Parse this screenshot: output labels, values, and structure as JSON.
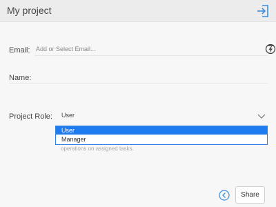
{
  "header": {
    "title": "My project",
    "exit_icon": "sign-in-icon"
  },
  "form": {
    "email": {
      "label": "Email:",
      "placeholder": "Add or Select Email...",
      "value": "",
      "action_icon": "bolt-icon"
    },
    "name": {
      "label": "Name:",
      "value": ""
    },
    "project_role": {
      "label": "Project Role:",
      "selected": "User",
      "options": [
        "User",
        "Manager"
      ],
      "description": "operations on assigned tasks."
    }
  },
  "footer": {
    "back_icon": "chevron-left-circle-icon",
    "share_label": "Share"
  },
  "colors": {
    "accent": "#1e7cf0",
    "header_bg": "#ececec",
    "page_bg": "#f7f7f7"
  }
}
